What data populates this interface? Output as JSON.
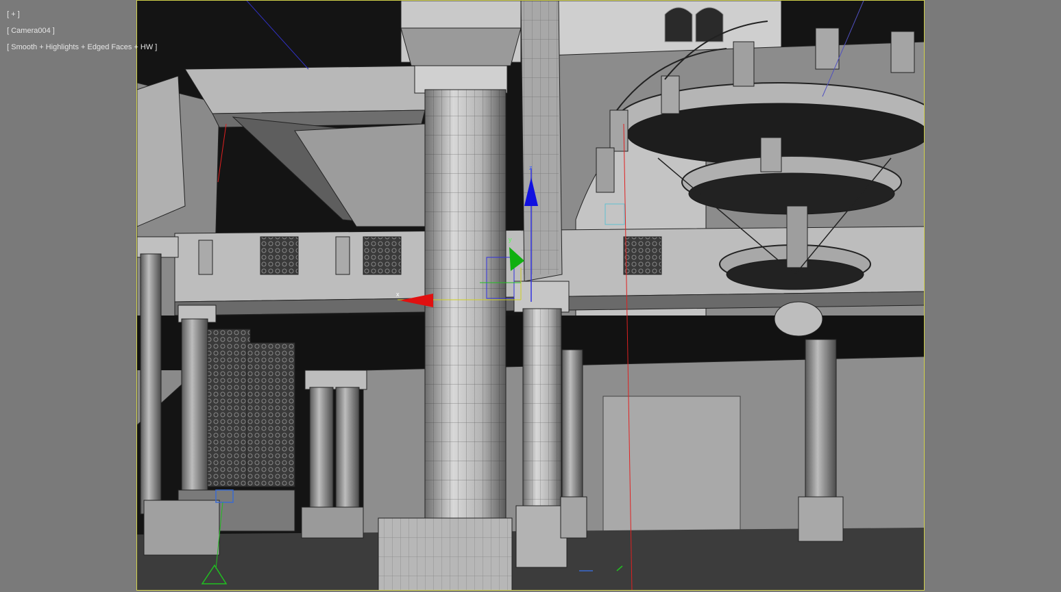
{
  "viewport": {
    "menu_label": "[ + ]",
    "camera_label": "[ Camera004 ]",
    "shading_label": "[ Smooth + Highlights + Edged Faces + HW ]",
    "border_color": "#d2d24a",
    "background_color": "#7a7a7a"
  },
  "gizmo": {
    "axis_x_label": "x",
    "axis_y_label": "y",
    "axis_z_label": "z",
    "x_color": "#e01010",
    "y_color": "#10c010",
    "z_color": "#1010e0"
  },
  "scene_objects": [
    "front-column",
    "middle-column",
    "left-columns",
    "chandelier",
    "balcony-railing",
    "ceiling-beam",
    "arch",
    "camera-target",
    "light-helper",
    "back-wall-panel"
  ]
}
